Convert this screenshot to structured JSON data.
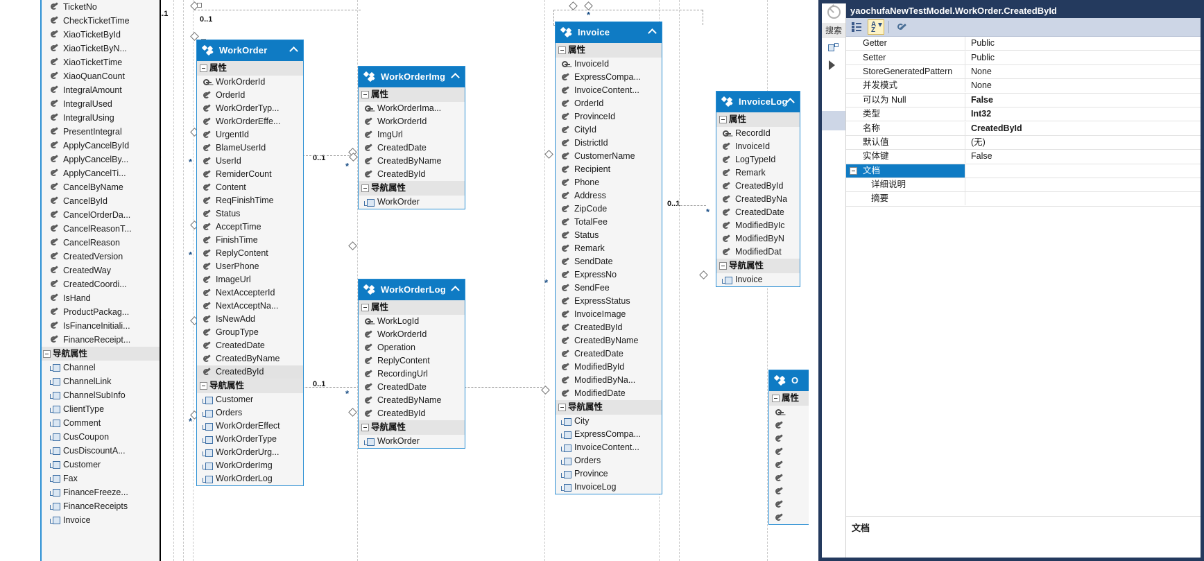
{
  "model_tree": {
    "items": [
      {
        "label": "TicketNo",
        "icon": "wrench-icon",
        "type": "scalar"
      },
      {
        "label": "CheckTicketTime",
        "icon": "wrench-icon",
        "type": "scalar"
      },
      {
        "label": "XiaoTicketById",
        "icon": "wrench-icon",
        "type": "scalar"
      },
      {
        "label": "XiaoTicketByN...",
        "icon": "wrench-icon",
        "type": "scalar"
      },
      {
        "label": "XiaoTicketTime",
        "icon": "wrench-icon",
        "type": "scalar"
      },
      {
        "label": "XiaoQuanCount",
        "icon": "wrench-icon",
        "type": "scalar"
      },
      {
        "label": "IntegralAmount",
        "icon": "wrench-icon",
        "type": "scalar"
      },
      {
        "label": "IntegralUsed",
        "icon": "wrench-icon",
        "type": "scalar"
      },
      {
        "label": "IntegralUsing",
        "icon": "wrench-icon",
        "type": "scalar"
      },
      {
        "label": "PresentIntegral",
        "icon": "wrench-icon",
        "type": "scalar"
      },
      {
        "label": "ApplyCancelById",
        "icon": "wrench-icon",
        "type": "scalar"
      },
      {
        "label": "ApplyCancelBy...",
        "icon": "wrench-icon",
        "type": "scalar"
      },
      {
        "label": "ApplyCancelTi...",
        "icon": "wrench-icon",
        "type": "scalar"
      },
      {
        "label": "CancelByName",
        "icon": "wrench-icon",
        "type": "scalar"
      },
      {
        "label": "CancelById",
        "icon": "wrench-icon",
        "type": "scalar"
      },
      {
        "label": "CancelOrderDa...",
        "icon": "wrench-icon",
        "type": "scalar"
      },
      {
        "label": "CancelReasonT...",
        "icon": "wrench-icon",
        "type": "scalar"
      },
      {
        "label": "CancelReason",
        "icon": "wrench-icon",
        "type": "scalar"
      },
      {
        "label": "CreatedVersion",
        "icon": "wrench-icon",
        "type": "scalar"
      },
      {
        "label": "CreatedWay",
        "icon": "wrench-icon",
        "type": "scalar"
      },
      {
        "label": "CreatedCoordi...",
        "icon": "wrench-icon",
        "type": "scalar"
      },
      {
        "label": "IsHand",
        "icon": "wrench-icon",
        "type": "scalar"
      },
      {
        "label": "ProductPackag...",
        "icon": "wrench-icon",
        "type": "scalar"
      },
      {
        "label": "IsFinanceInitiali...",
        "icon": "wrench-icon",
        "type": "scalar"
      },
      {
        "label": "FinanceReceipt...",
        "icon": "wrench-icon",
        "type": "scalar"
      },
      {
        "label": "导航属性",
        "icon": "expander-icon",
        "type": "group"
      },
      {
        "label": "Channel",
        "icon": "nav-icon",
        "type": "nav"
      },
      {
        "label": "ChannelLink",
        "icon": "nav-icon",
        "type": "nav"
      },
      {
        "label": "ChannelSubInfo",
        "icon": "nav-icon",
        "type": "nav"
      },
      {
        "label": "ClientType",
        "icon": "nav-icon",
        "type": "nav"
      },
      {
        "label": "Comment",
        "icon": "nav-icon",
        "type": "nav"
      },
      {
        "label": "CusCoupon",
        "icon": "nav-icon",
        "type": "nav"
      },
      {
        "label": "CusDiscountA...",
        "icon": "nav-icon",
        "type": "nav"
      },
      {
        "label": "Customer",
        "icon": "nav-icon",
        "type": "nav"
      },
      {
        "label": "Fax",
        "icon": "nav-icon",
        "type": "nav"
      },
      {
        "label": "FinanceFreeze...",
        "icon": "nav-icon",
        "type": "nav"
      },
      {
        "label": "FinanceReceipts",
        "icon": "nav-icon",
        "type": "nav"
      },
      {
        "label": "Invoice",
        "icon": "nav-icon",
        "type": "nav"
      }
    ]
  },
  "canvas": {
    "section_labels": {
      "properties": "属性",
      "navigation": "导航属性"
    },
    "entities": [
      {
        "name": "WorkOrder",
        "properties": [
          {
            "label": "WorkOrderId",
            "icon": "key-icon"
          },
          {
            "label": "OrderId",
            "icon": "wrench-icon"
          },
          {
            "label": "WorkOrderTyp...",
            "icon": "wrench-icon"
          },
          {
            "label": "WorkOrderEffe...",
            "icon": "wrench-icon"
          },
          {
            "label": "UrgentId",
            "icon": "wrench-icon"
          },
          {
            "label": "BlameUserId",
            "icon": "wrench-icon"
          },
          {
            "label": "UserId",
            "icon": "wrench-icon"
          },
          {
            "label": "RemiderCount",
            "icon": "wrench-icon"
          },
          {
            "label": "Content",
            "icon": "wrench-icon"
          },
          {
            "label": "ReqFinishTime",
            "icon": "wrench-icon"
          },
          {
            "label": "Status",
            "icon": "wrench-icon"
          },
          {
            "label": "AcceptTime",
            "icon": "wrench-icon"
          },
          {
            "label": "FinishTime",
            "icon": "wrench-icon"
          },
          {
            "label": "ReplyContent",
            "icon": "wrench-icon"
          },
          {
            "label": "UserPhone",
            "icon": "wrench-icon"
          },
          {
            "label": "ImageUrl",
            "icon": "wrench-icon"
          },
          {
            "label": "NextAccepterId",
            "icon": "wrench-icon"
          },
          {
            "label": "NextAcceptNa...",
            "icon": "wrench-icon"
          },
          {
            "label": "IsNewAdd",
            "icon": "wrench-icon"
          },
          {
            "label": "GroupType",
            "icon": "wrench-icon"
          },
          {
            "label": "CreatedDate",
            "icon": "wrench-icon"
          },
          {
            "label": "CreatedByName",
            "icon": "wrench-icon"
          },
          {
            "label": "CreatedById",
            "icon": "wrench-icon",
            "selected": true
          }
        ],
        "navigation": [
          {
            "label": "Customer",
            "icon": "nav-icon"
          },
          {
            "label": "Orders",
            "icon": "nav-icon"
          },
          {
            "label": "WorkOrderEffect",
            "icon": "nav-icon"
          },
          {
            "label": "WorkOrderType",
            "icon": "nav-icon"
          },
          {
            "label": "WorkOrderUrg...",
            "icon": "nav-icon"
          },
          {
            "label": "WorkOrderImg",
            "icon": "nav-icon"
          },
          {
            "label": "WorkOrderLog",
            "icon": "nav-icon"
          }
        ]
      },
      {
        "name": "WorkOrderImg",
        "properties": [
          {
            "label": "WorkOrderIma...",
            "icon": "key-icon"
          },
          {
            "label": "WorkOrderId",
            "icon": "wrench-icon"
          },
          {
            "label": "ImgUrl",
            "icon": "wrench-icon"
          },
          {
            "label": "CreatedDate",
            "icon": "wrench-icon"
          },
          {
            "label": "CreatedByName",
            "icon": "wrench-icon"
          },
          {
            "label": "CreatedById",
            "icon": "wrench-icon"
          }
        ],
        "navigation": [
          {
            "label": "WorkOrder",
            "icon": "nav-icon"
          }
        ]
      },
      {
        "name": "WorkOrderLog",
        "properties": [
          {
            "label": "WorkLogId",
            "icon": "key-icon"
          },
          {
            "label": "WorkOrderId",
            "icon": "wrench-icon"
          },
          {
            "label": "Operation",
            "icon": "wrench-icon"
          },
          {
            "label": "ReplyContent",
            "icon": "wrench-icon"
          },
          {
            "label": "RecordingUrl",
            "icon": "wrench-icon"
          },
          {
            "label": "CreatedDate",
            "icon": "wrench-icon"
          },
          {
            "label": "CreatedByName",
            "icon": "wrench-icon"
          },
          {
            "label": "CreatedById",
            "icon": "wrench-icon"
          }
        ],
        "navigation": [
          {
            "label": "WorkOrder",
            "icon": "nav-icon"
          }
        ]
      },
      {
        "name": "Invoice",
        "properties": [
          {
            "label": "InvoiceId",
            "icon": "key-icon"
          },
          {
            "label": "ExpressCompa...",
            "icon": "wrench-icon"
          },
          {
            "label": "InvoiceContent...",
            "icon": "wrench-icon"
          },
          {
            "label": "OrderId",
            "icon": "wrench-icon"
          },
          {
            "label": "ProvinceId",
            "icon": "wrench-icon"
          },
          {
            "label": "CityId",
            "icon": "wrench-icon"
          },
          {
            "label": "DistrictId",
            "icon": "wrench-icon"
          },
          {
            "label": "CustomerName",
            "icon": "wrench-icon"
          },
          {
            "label": "Recipient",
            "icon": "wrench-icon"
          },
          {
            "label": "Phone",
            "icon": "wrench-icon"
          },
          {
            "label": "Address",
            "icon": "wrench-icon"
          },
          {
            "label": "ZipCode",
            "icon": "wrench-icon"
          },
          {
            "label": "TotalFee",
            "icon": "wrench-icon"
          },
          {
            "label": "Status",
            "icon": "wrench-icon"
          },
          {
            "label": "Remark",
            "icon": "wrench-icon"
          },
          {
            "label": "SendDate",
            "icon": "wrench-icon"
          },
          {
            "label": "ExpressNo",
            "icon": "wrench-icon"
          },
          {
            "label": "SendFee",
            "icon": "wrench-icon"
          },
          {
            "label": "ExpressStatus",
            "icon": "wrench-icon"
          },
          {
            "label": "InvoiceImage",
            "icon": "wrench-icon"
          },
          {
            "label": "CreatedById",
            "icon": "wrench-icon"
          },
          {
            "label": "CreatedByName",
            "icon": "wrench-icon"
          },
          {
            "label": "CreatedDate",
            "icon": "wrench-icon"
          },
          {
            "label": "ModifiedById",
            "icon": "wrench-icon"
          },
          {
            "label": "ModifiedByNa...",
            "icon": "wrench-icon"
          },
          {
            "label": "ModifiedDate",
            "icon": "wrench-icon"
          }
        ],
        "navigation": [
          {
            "label": "City",
            "icon": "nav-icon"
          },
          {
            "label": "ExpressCompa...",
            "icon": "nav-icon"
          },
          {
            "label": "InvoiceContent...",
            "icon": "nav-icon"
          },
          {
            "label": "Orders",
            "icon": "nav-icon"
          },
          {
            "label": "Province",
            "icon": "nav-icon"
          },
          {
            "label": "InvoiceLog",
            "icon": "nav-icon"
          }
        ]
      },
      {
        "name": "InvoiceLog",
        "properties": [
          {
            "label": "RecordId",
            "icon": "key-icon"
          },
          {
            "label": "InvoiceId",
            "icon": "wrench-icon"
          },
          {
            "label": "LogTypeId",
            "icon": "wrench-icon"
          },
          {
            "label": "Remark",
            "icon": "wrench-icon"
          },
          {
            "label": "CreatedById",
            "icon": "wrench-icon"
          },
          {
            "label": "CreatedByNa",
            "icon": "wrench-icon"
          },
          {
            "label": "CreatedDate",
            "icon": "wrench-icon"
          },
          {
            "label": "ModifiedByIc",
            "icon": "wrench-icon"
          },
          {
            "label": "ModifiedByN",
            "icon": "wrench-icon"
          },
          {
            "label": "ModifiedDat",
            "icon": "wrench-icon"
          }
        ],
        "navigation": [
          {
            "label": "Invoice",
            "icon": "nav-icon"
          }
        ]
      },
      {
        "name": "O",
        "properties": [],
        "navigation": []
      }
    ],
    "multiplicities": [
      "0..1",
      "1",
      "*"
    ]
  },
  "properties_pane": {
    "title": "yaochufaNewTestModel.WorkOrder.CreatedById",
    "search_tab_label": "搜索",
    "toolbar": {
      "categorized_label": "categorized-view",
      "alphabetical_label": "alphabetical-sort",
      "property_pages_label": "property-pages"
    },
    "rows": [
      {
        "name": "Getter",
        "value": "Public",
        "bold": false
      },
      {
        "name": "Setter",
        "value": "Public",
        "bold": false
      },
      {
        "name": "StoreGeneratedPattern",
        "value": "None",
        "bold": false
      },
      {
        "name": "并发模式",
        "value": "None",
        "bold": false
      },
      {
        "name": "可以为 Null",
        "value": "False",
        "bold": true
      },
      {
        "name": "类型",
        "value": "Int32",
        "bold": true
      },
      {
        "name": "名称",
        "value": "CreatedById",
        "bold": true
      },
      {
        "name": "默认值",
        "value": "(无)",
        "bold": false
      },
      {
        "name": "实体键",
        "value": "False",
        "bold": false
      },
      {
        "name": "文档",
        "value": "",
        "bold": false,
        "selected": true,
        "expander": true
      },
      {
        "name": "详细说明",
        "value": "",
        "bold": false,
        "indent": true
      },
      {
        "name": "摘要",
        "value": "",
        "bold": false,
        "indent": true
      }
    ],
    "footer_label": "文档"
  },
  "colors": {
    "entity_header": "#0f7bc4",
    "entity_border": "#2b8fd4",
    "selection_blue": "#0f7bc4",
    "title_bar": "#243a5e",
    "toolbar": "#cdd6e6",
    "annotation_pink": "#ff2e9e"
  }
}
